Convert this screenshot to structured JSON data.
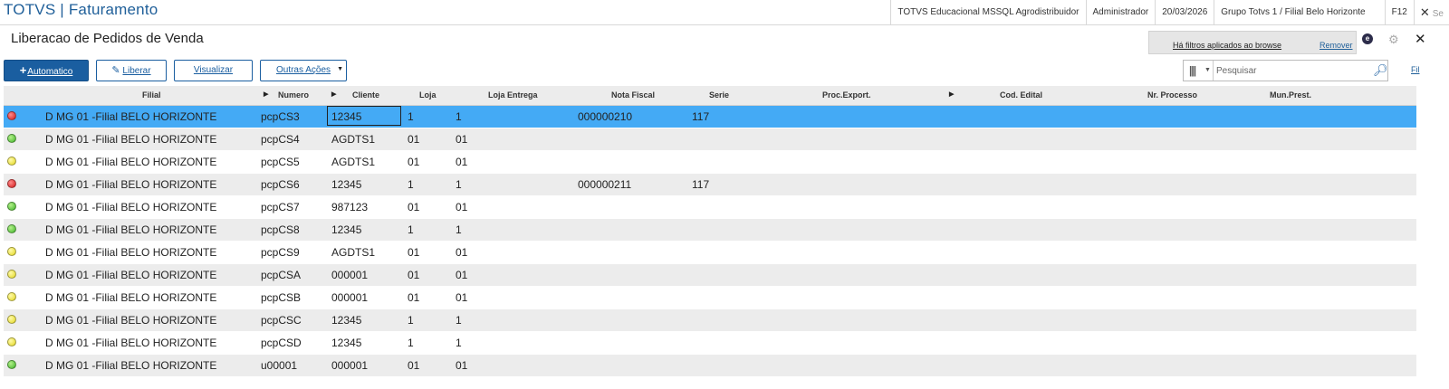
{
  "app": {
    "title": "TOTVS | Faturamento"
  },
  "topbar": {
    "environment": "TOTVS Educacional MSSQL Agrodistribuidor",
    "user": "Administrador",
    "date": "20/03/2026",
    "branch": "Grupo Totvs 1 / Filial Belo Horizonte",
    "help_key": "F12",
    "close_label": "Se"
  },
  "page": {
    "title": "Liberacao de Pedidos de Venda"
  },
  "filter_notice": {
    "text": "Há filtros aplicados ao browse",
    "remove_label": "Remover"
  },
  "toolbar": {
    "automatico_label": "Automatico",
    "liberar_label": "Liberar",
    "visualizar_label": "Visualizar",
    "outras_label": "Outras Ações"
  },
  "search": {
    "placeholder": "Pesquisar",
    "filter_link": "Fil"
  },
  "grid": {
    "columns": {
      "filial": "Filial",
      "numero": "Numero",
      "cliente": "Cliente",
      "loja": "Loja",
      "loja_entrega": "Loja Entrega",
      "nota_fiscal": "Nota Fiscal",
      "serie": "Serie",
      "proc_export": "Proc.Export.",
      "cod_edital": "Cod. Edital",
      "nr_processo": "Nr. Processo",
      "mun_prest": "Mun.Prest."
    },
    "rows": [
      {
        "status": "red",
        "filial": "D MG 01 -Filial BELO HORIZONTE",
        "numero": "pcpCS3",
        "cliente": "12345",
        "loja": "1",
        "loja_entrega": "1",
        "nota_fiscal": "000000210",
        "serie": "117"
      },
      {
        "status": "green",
        "filial": "D MG 01 -Filial BELO HORIZONTE",
        "numero": "pcpCS4",
        "cliente": "AGDTS1",
        "loja": "01",
        "loja_entrega": "01",
        "nota_fiscal": "",
        "serie": ""
      },
      {
        "status": "yellow",
        "filial": "D MG 01 -Filial BELO HORIZONTE",
        "numero": "pcpCS5",
        "cliente": "AGDTS1",
        "loja": "01",
        "loja_entrega": "01",
        "nota_fiscal": "",
        "serie": ""
      },
      {
        "status": "red",
        "filial": "D MG 01 -Filial BELO HORIZONTE",
        "numero": "pcpCS6",
        "cliente": "12345",
        "loja": "1",
        "loja_entrega": "1",
        "nota_fiscal": "000000211",
        "serie": "117"
      },
      {
        "status": "green",
        "filial": "D MG 01 -Filial BELO HORIZONTE",
        "numero": "pcpCS7",
        "cliente": "987123",
        "loja": "01",
        "loja_entrega": "01",
        "nota_fiscal": "",
        "serie": ""
      },
      {
        "status": "green",
        "filial": "D MG 01 -Filial BELO HORIZONTE",
        "numero": "pcpCS8",
        "cliente": "12345",
        "loja": "1",
        "loja_entrega": "1",
        "nota_fiscal": "",
        "serie": ""
      },
      {
        "status": "yellow",
        "filial": "D MG 01 -Filial BELO HORIZONTE",
        "numero": "pcpCS9",
        "cliente": "AGDTS1",
        "loja": "01",
        "loja_entrega": "01",
        "nota_fiscal": "",
        "serie": ""
      },
      {
        "status": "yellow",
        "filial": "D MG 01 -Filial BELO HORIZONTE",
        "numero": "pcpCSA",
        "cliente": "000001",
        "loja": "01",
        "loja_entrega": "01",
        "nota_fiscal": "",
        "serie": ""
      },
      {
        "status": "yellow",
        "filial": "D MG 01 -Filial BELO HORIZONTE",
        "numero": "pcpCSB",
        "cliente": "000001",
        "loja": "01",
        "loja_entrega": "01",
        "nota_fiscal": "",
        "serie": ""
      },
      {
        "status": "yellow",
        "filial": "D MG 01 -Filial BELO HORIZONTE",
        "numero": "pcpCSC",
        "cliente": "12345",
        "loja": "1",
        "loja_entrega": "1",
        "nota_fiscal": "",
        "serie": ""
      },
      {
        "status": "yellow",
        "filial": "D MG 01 -Filial BELO HORIZONTE",
        "numero": "pcpCSD",
        "cliente": "12345",
        "loja": "1",
        "loja_entrega": "1",
        "nota_fiscal": "",
        "serie": ""
      },
      {
        "status": "green",
        "filial": "D MG 01 -Filial BELO HORIZONTE",
        "numero": "u00001",
        "cliente": "000001",
        "loja": "01",
        "loja_entrega": "01",
        "nota_fiscal": "",
        "serie": ""
      }
    ],
    "selected_row": 0,
    "status_colors": {
      "red": "#d31a1a",
      "green": "#3fb42a",
      "yellow": "#e2d720"
    },
    "selection_color": "#44aaf5"
  },
  "icons": {
    "add": "plus-icon",
    "edit": "pencil-icon",
    "columns": "columns-icon",
    "search": "search-icon",
    "gear": "gear-icon",
    "close": "close-icon"
  }
}
